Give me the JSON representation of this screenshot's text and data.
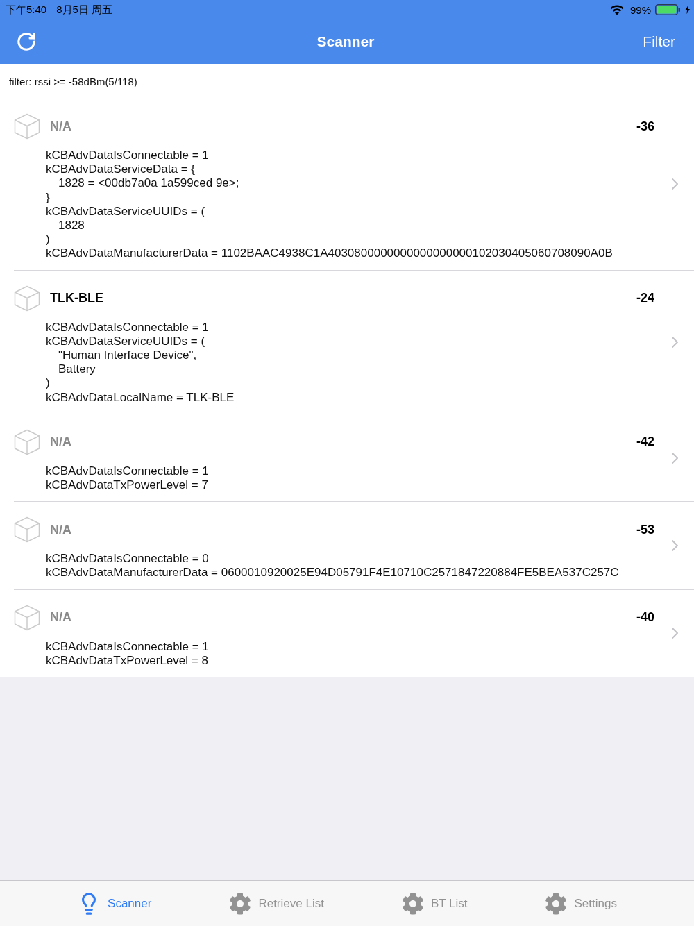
{
  "status_bar": {
    "time": "下午5:40",
    "date": "8月5日 周五",
    "battery": "99%"
  },
  "nav_bar": {
    "title": "Scanner",
    "right_button": "Filter"
  },
  "filter_summary": "filter: rssi >= -58dBm(5/118)",
  "devices": [
    {
      "name": "N/A",
      "unnamed": true,
      "rssi": "-36",
      "adv_lines": [
        {
          "text": "kCBAdvDataIsConnectable = 1"
        },
        {
          "text": "kCBAdvDataServiceData = {",
          "children": [
            {
              "text": "1828 = <00db7a0a 1a599ced 9e>;"
            }
          ]
        },
        {
          "text": "}"
        },
        {
          "text": "kCBAdvDataServiceUUIDs = (",
          "children": [
            {
              "text": "1828"
            }
          ]
        },
        {
          "text": ")"
        },
        {
          "text": "kCBAdvDataManufacturerData = 1102BAAC4938C1A4030800000000000000000102030405060708090A0B"
        }
      ]
    },
    {
      "name": "TLK-BLE",
      "unnamed": false,
      "rssi": "-24",
      "adv_lines": [
        {
          "text": "kCBAdvDataIsConnectable = 1"
        },
        {
          "text": "kCBAdvDataServiceUUIDs = (",
          "children": [
            {
              "text": "\"Human Interface Device\","
            },
            {
              "text": "Battery"
            }
          ]
        },
        {
          "text": ")"
        },
        {
          "text": "kCBAdvDataLocalName = TLK-BLE"
        }
      ]
    },
    {
      "name": "N/A",
      "unnamed": true,
      "rssi": "-42",
      "adv_lines": [
        {
          "text": "kCBAdvDataIsConnectable = 1"
        },
        {
          "text": "kCBAdvDataTxPowerLevel = 7"
        }
      ]
    },
    {
      "name": "N/A",
      "unnamed": true,
      "rssi": "-53",
      "adv_lines": [
        {
          "text": "kCBAdvDataIsConnectable = 0"
        },
        {
          "text": "kCBAdvDataManufacturerData = 0600010920025E94D05791F4E10710C2571847220884FE5BEA537C257C"
        }
      ]
    },
    {
      "name": "N/A",
      "unnamed": true,
      "rssi": "-40",
      "adv_lines": [
        {
          "text": "kCBAdvDataIsConnectable = 1"
        },
        {
          "text": "kCBAdvDataTxPowerLevel = 8"
        }
      ]
    }
  ],
  "tab_bar": [
    {
      "label": "Scanner",
      "kind": "bulb",
      "selected": true
    },
    {
      "label": "Retrieve List",
      "kind": "gear",
      "selected": false
    },
    {
      "label": "BT List",
      "kind": "gear",
      "selected": false
    },
    {
      "label": "Settings",
      "kind": "gear",
      "selected": false
    }
  ]
}
